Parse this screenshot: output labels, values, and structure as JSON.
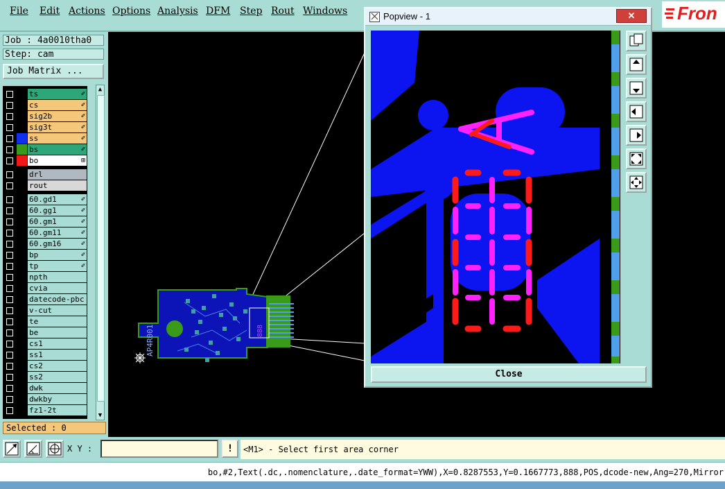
{
  "menu": [
    "File",
    "Edit",
    "Actions",
    "Options",
    "Analysis",
    "DFM",
    "Step",
    "Rout",
    "Windows"
  ],
  "logo": {
    "text": "Fron"
  },
  "job": {
    "label": "Job : 4a0010tha0",
    "step": "Step: cam",
    "matrix_button": "Job Matrix ..."
  },
  "layers": [
    {
      "name": "ts",
      "color": "#2da77a",
      "fill": "",
      "mark": "✐"
    },
    {
      "name": "cs",
      "color": "#f5c77a",
      "fill": "",
      "mark": "✐"
    },
    {
      "name": "sig2b",
      "color": "#f5c77a",
      "fill": "",
      "mark": "✐"
    },
    {
      "name": "sig3t",
      "color": "#f5c77a",
      "fill": "",
      "mark": "✐"
    },
    {
      "name": "ss",
      "color": "#f5c77a",
      "fill": "#1030f0",
      "mark": "✐"
    },
    {
      "name": "bs",
      "color": "#2da77a",
      "fill": "#3a9a1a",
      "mark": "✐"
    },
    {
      "name": "bo",
      "color": "#ffffff",
      "fill": "#f01818",
      "mark": "⊞"
    },
    {
      "name": "drl",
      "color": "#b0b8c0",
      "fill": "",
      "mark": ""
    },
    {
      "name": "rout",
      "color": "#d8d8d8",
      "fill": "",
      "mark": ""
    },
    {
      "name": "60.gd1",
      "color": "#a8dcd4",
      "fill": "",
      "mark": "✐"
    },
    {
      "name": "60.gg1",
      "color": "#a8dcd4",
      "fill": "",
      "mark": "✐"
    },
    {
      "name": "60.gm1",
      "color": "#a8dcd4",
      "fill": "",
      "mark": "✐"
    },
    {
      "name": "60.gm11",
      "color": "#a8dcd4",
      "fill": "",
      "mark": "✐"
    },
    {
      "name": "60.gm16",
      "color": "#a8dcd4",
      "fill": "",
      "mark": "✐"
    },
    {
      "name": "bp",
      "color": "#a8dcd4",
      "fill": "",
      "mark": "✐"
    },
    {
      "name": "tp",
      "color": "#a8dcd4",
      "fill": "",
      "mark": "✐"
    },
    {
      "name": "npth",
      "color": "#a8dcd4",
      "fill": "",
      "mark": ""
    },
    {
      "name": "cvia",
      "color": "#a8dcd4",
      "fill": "",
      "mark": ""
    },
    {
      "name": "datecode-pbc",
      "color": "#a8dcd4",
      "fill": "",
      "mark": ""
    },
    {
      "name": "v-cut",
      "color": "#a8dcd4",
      "fill": "",
      "mark": ""
    },
    {
      "name": "te",
      "color": "#a8dcd4",
      "fill": "",
      "mark": ""
    },
    {
      "name": "be",
      "color": "#a8dcd4",
      "fill": "",
      "mark": ""
    },
    {
      "name": "cs1",
      "color": "#a8dcd4",
      "fill": "",
      "mark": ""
    },
    {
      "name": "ss1",
      "color": "#a8dcd4",
      "fill": "",
      "mark": ""
    },
    {
      "name": "cs2",
      "color": "#a8dcd4",
      "fill": "",
      "mark": ""
    },
    {
      "name": "ss2",
      "color": "#a8dcd4",
      "fill": "",
      "mark": ""
    },
    {
      "name": "dwk",
      "color": "#a8dcd4",
      "fill": "",
      "mark": ""
    },
    {
      "name": "dwkby",
      "color": "#a8dcd4",
      "fill": "",
      "mark": ""
    },
    {
      "name": "fz1-2t",
      "color": "#a8dcd4",
      "fill": "",
      "mark": ""
    }
  ],
  "selected": "Selected : 0",
  "bottom": {
    "xy_label": "X Y :",
    "xy_value": "",
    "warn": "!",
    "prompt": "<M1> - Select first area corner"
  },
  "status": "bo,#2,Text(.dc,.nomenclature,.date_format=YWW),X=0.8287553,Y=0.1667773,888,POS,dcode-new,Ang=270,Mirror",
  "popview": {
    "title": "Popview - 1",
    "close_x": "✕",
    "close_button": "Close",
    "glyph": "A"
  },
  "board": {
    "text": "AP4R001",
    "code": "888"
  }
}
